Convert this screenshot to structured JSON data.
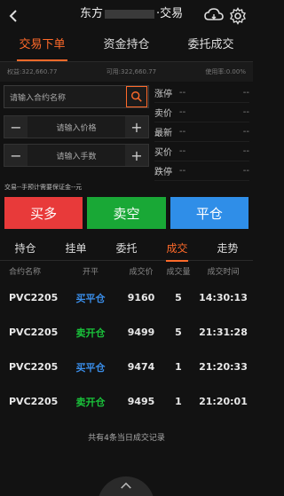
{
  "header": {
    "title_prefix": "东方",
    "title_suffix": "·交易"
  },
  "main_tabs": [
    {
      "label": "交易下单"
    },
    {
      "label": "资金持仓"
    },
    {
      "label": "委托成交"
    }
  ],
  "account": {
    "equity": "权益:322,660.77",
    "available": "可用:322,660.77",
    "usage": "使用率:0.00%"
  },
  "order_form": {
    "contract_placeholder": "请输入合约名称",
    "price_placeholder": "请输入价格",
    "qty_placeholder": "请输入手数",
    "minus": "−",
    "plus": "+"
  },
  "quote": [
    {
      "label": "涨停",
      "v1": "--",
      "v2": "--"
    },
    {
      "label": "卖价",
      "v1": "--",
      "v2": "--"
    },
    {
      "label": "最新",
      "v1": "--",
      "v2": "--"
    },
    {
      "label": "买价",
      "v1": "--",
      "v2": "--"
    },
    {
      "label": "跌停",
      "v1": "--",
      "v2": "--"
    }
  ],
  "hint": "交易--手预计需要保证金--元",
  "actions": {
    "buy_long": "买多",
    "sell_short": "卖空",
    "close": "平仓"
  },
  "sub_tabs": [
    {
      "label": "持仓"
    },
    {
      "label": "挂单"
    },
    {
      "label": "委托"
    },
    {
      "label": "成交"
    },
    {
      "label": "走势"
    }
  ],
  "table": {
    "headers": [
      "合约名称",
      "开平",
      "成交价",
      "成交量",
      "成交时间"
    ],
    "rows": [
      {
        "contract": "PVC2205",
        "side": "买平仓",
        "price": "9160",
        "qty": "5",
        "time": "14:30:13"
      },
      {
        "contract": "PVC2205",
        "side": "卖开仓",
        "price": "9499",
        "qty": "5",
        "time": "21:31:28"
      },
      {
        "contract": "PVC2205",
        "side": "买平仓",
        "price": "9474",
        "qty": "1",
        "time": "21:20:33"
      },
      {
        "contract": "PVC2205",
        "side": "卖开仓",
        "price": "9495",
        "qty": "1",
        "time": "21:20:01"
      }
    ],
    "footnote": "共有4条当日成交记录"
  },
  "colors": {
    "accent": "#ff6a2a",
    "buy_red": "#e83a3a",
    "sell_green": "#19a836",
    "close_blue": "#2f8ee8"
  },
  "icons": [
    "back-chevron-icon",
    "cloud-sync-icon",
    "gear-icon",
    "search-icon",
    "chevron-up-icon"
  ]
}
